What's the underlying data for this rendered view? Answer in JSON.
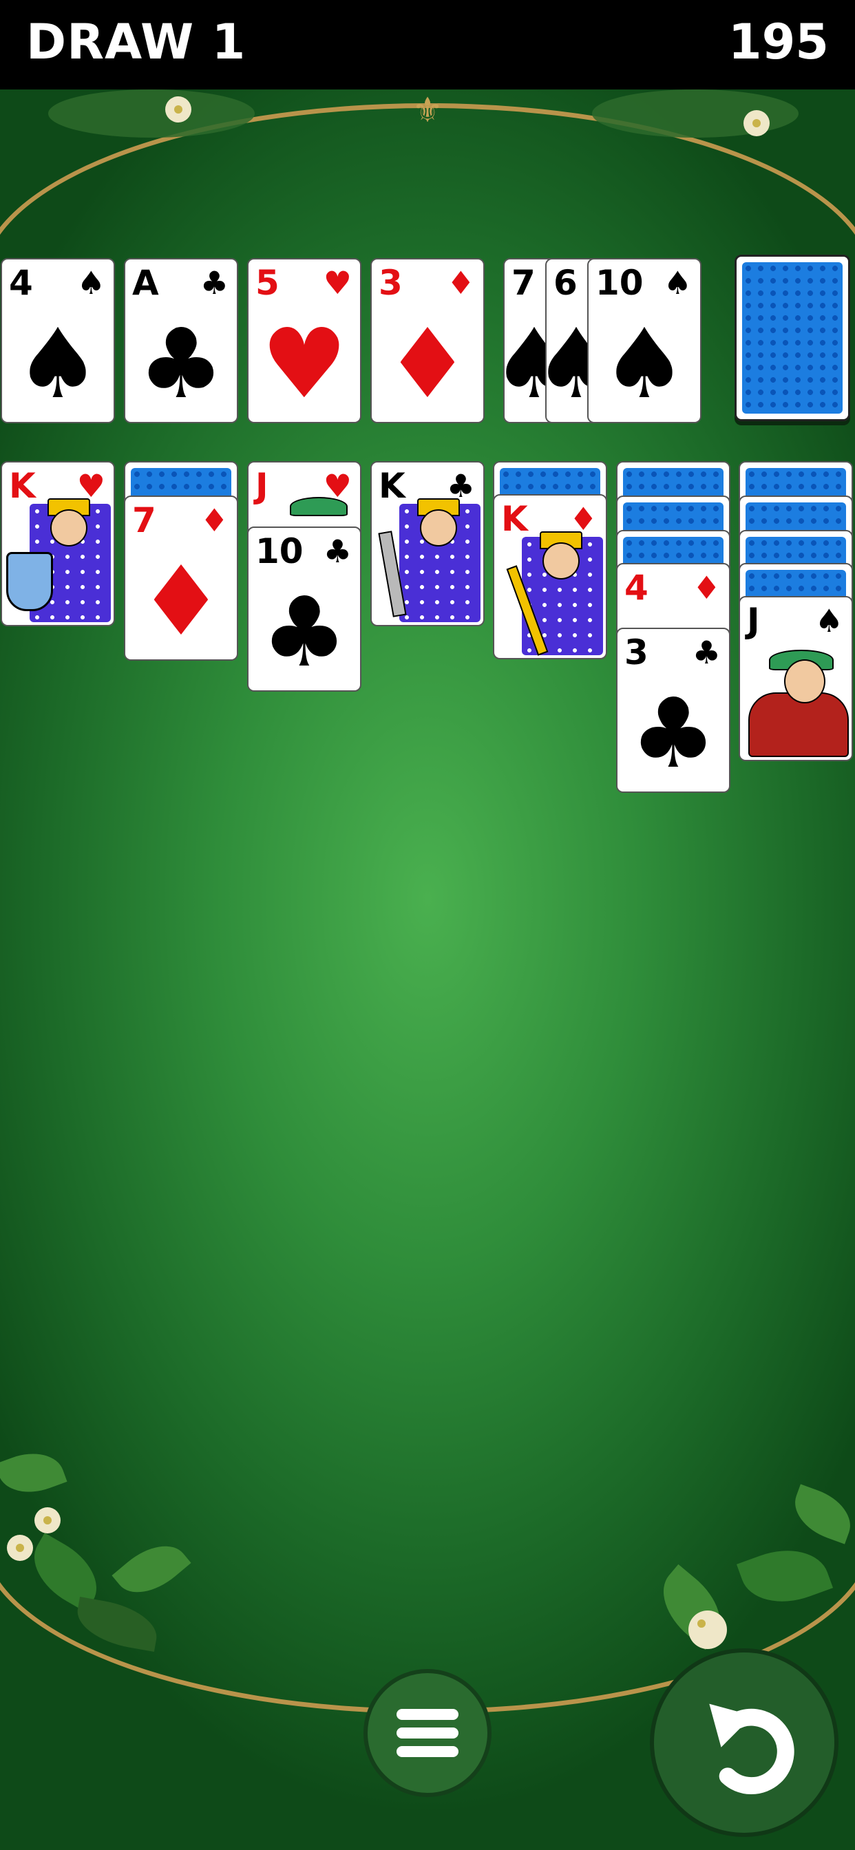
{
  "header": {
    "mode_label": "DRAW 1",
    "score": "195"
  },
  "colors": {
    "felt": "#3fa146",
    "table_edge": "#b9944b",
    "card_back": "#1c7de0",
    "red_suit": "#e30f14"
  },
  "waste": [
    {
      "rank": "4",
      "suit": "♠",
      "color": "black"
    },
    {
      "rank": "A",
      "suit": "♣",
      "color": "black"
    },
    {
      "rank": "5",
      "suit": "♥",
      "color": "red"
    },
    {
      "rank": "3",
      "suit": "♦",
      "color": "red"
    },
    {
      "rank": "7",
      "suit": "♠",
      "color": "black"
    },
    {
      "rank": "6",
      "suit": "♠",
      "color": "black"
    },
    {
      "rank": "10",
      "suit": "♠",
      "color": "black"
    }
  ],
  "stock": {
    "face_down": true
  },
  "tableau": [
    {
      "facedown_count": 0,
      "cards": [
        {
          "rank": "K",
          "suit": "♥",
          "color": "red",
          "face": "king"
        }
      ]
    },
    {
      "facedown_count": 1,
      "cards": [
        {
          "rank": "7",
          "suit": "♦",
          "color": "red"
        }
      ]
    },
    {
      "facedown_count": 0,
      "cards": [
        {
          "rank": "J",
          "suit": "♥",
          "color": "red",
          "face": "jack"
        },
        {
          "rank": "10",
          "suit": "♣",
          "color": "black"
        }
      ]
    },
    {
      "facedown_count": 0,
      "cards": [
        {
          "rank": "K",
          "suit": "♣",
          "color": "black",
          "face": "king"
        }
      ]
    },
    {
      "facedown_count": 1,
      "cards": [
        {
          "rank": "K",
          "suit": "♦",
          "color": "red",
          "face": "king"
        }
      ]
    },
    {
      "facedown_count": 3,
      "cards": [
        {
          "rank": "4",
          "suit": "♦",
          "color": "red"
        },
        {
          "rank": "3",
          "suit": "♣",
          "color": "black"
        }
      ]
    },
    {
      "facedown_count": 4,
      "cards": [
        {
          "rank": "J",
          "suit": "♠",
          "color": "black",
          "face": "jack"
        }
      ]
    }
  ],
  "controls": {
    "menu_icon": "hamburger-icon",
    "undo_icon": "undo-icon"
  }
}
